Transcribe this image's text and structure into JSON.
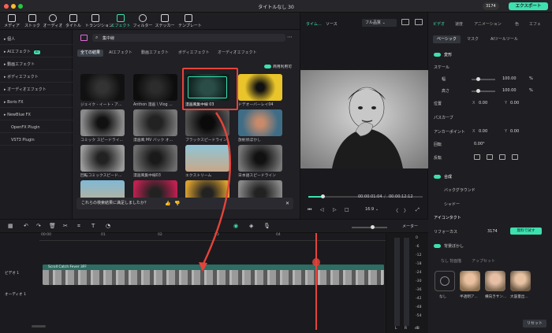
{
  "window": {
    "title": "タイトルなし 30",
    "credits": "3174",
    "export_label": "エクスポート"
  },
  "toolbar": {
    "items": [
      {
        "label": "メディア",
        "icon": "media-icon"
      },
      {
        "label": "ストック",
        "icon": "stock-icon"
      },
      {
        "label": "オーディオ",
        "icon": "music-icon"
      },
      {
        "label": "タイトル",
        "icon": "title-icon"
      },
      {
        "label": "トランジション",
        "icon": "transition-icon"
      },
      {
        "label": "エフェクト",
        "icon": "effects-icon"
      },
      {
        "label": "フィルター",
        "icon": "filter-icon"
      },
      {
        "label": "ステッカー",
        "icon": "sticker-icon"
      },
      {
        "label": "テンプレート",
        "icon": "template-icon"
      }
    ],
    "active": "エフェクト"
  },
  "sidebar": {
    "items": [
      {
        "label": "個人"
      },
      {
        "label": "AIエフェクト",
        "badge": "AI"
      },
      {
        "label": "動画エフェクト"
      },
      {
        "label": "ボディエフェクト"
      },
      {
        "label": "オーディオエフェクト"
      },
      {
        "label": "Boris FX"
      },
      {
        "label": "NewBlue FX"
      },
      {
        "label": "OpenFX Plugin"
      },
      {
        "label": "VST3 Plugin"
      }
    ]
  },
  "browser": {
    "search_value": "集中線",
    "category_tabs": [
      "全ての結果",
      "AIエフェクト",
      "動画エフェクト",
      "ボディエフェクト",
      "オーディオエフェクト"
    ],
    "commercial_toggle_label": "商用利用可",
    "feedback_text": "これらの検索結果に満足しましたか？",
    "tiles": [
      {
        "label": "ジェイク - イート・ア..."
      },
      {
        "label": "Anthon 漫画 \\ Vlog ..."
      },
      {
        "label": "漫画風集中線 03"
      },
      {
        "label": "ドデオーバーレイ04"
      },
      {
        "label": "コミック スピードライ..."
      },
      {
        "label": "漫画風 MV バック オ..."
      },
      {
        "label": "ブラックスピードライン"
      },
      {
        "label": "放射状ぼかし"
      },
      {
        "label": "回転コミックスピード..."
      },
      {
        "label": "漫画風集中線03"
      },
      {
        "label": "エクストリーム"
      },
      {
        "label": "日本語スピードライン"
      },
      {
        "label": ""
      },
      {
        "label": ""
      },
      {
        "label": ""
      },
      {
        "label": ""
      }
    ]
  },
  "player": {
    "tabs": [
      "タイム...",
      "ソース"
    ],
    "quality": "フル品質",
    "current_time": "00:00:01:04",
    "total_time": "00:00:12:12",
    "ratio": "16:9"
  },
  "props": {
    "tabs": [
      "ビデオ",
      "速度",
      "アニメーション",
      "色",
      "エフェ"
    ],
    "subtabs": [
      "ベーシック",
      "マスク",
      "AIツールツール"
    ],
    "transform_label": "変形",
    "scale_label": "スケール",
    "w_label": "幅",
    "h_label": "高さ",
    "scale_w": "100.00",
    "scale_h": "100.00",
    "pct": "%",
    "position_label": "位置",
    "pos_x": "0.00",
    "pos_y": "0.00",
    "path_label": "パスカーブ",
    "anchor_label": "アンカーポイント",
    "anchor_x": "0.00",
    "anchor_y": "0.00",
    "rotate_label": "回転",
    "rotate_value": "0.00°",
    "flip_label": "反転",
    "composite_label": "合成",
    "background_label": "バックグラウンド",
    "shadow_label": "シャドー",
    "ai_icon_label": "アイコンタクト",
    "refocus_label": "リフォーカス",
    "refocus_credits": "3174",
    "free_label": "無料で試す",
    "portrait_label": "背景ぼかし",
    "subtab2": [
      "なし",
      "背面描",
      "アップセット"
    ],
    "presets": [
      "なし",
      "半透明ア...",
      "横向きサン...",
      "大容量出..."
    ],
    "reset_label": "リセット"
  },
  "timeline": {
    "ticks": [
      "00:00",
      "01",
      "02",
      "03",
      "04"
    ],
    "clip_title": "Scroll Catch Fever 3FF",
    "video_track": "ビデオ 1",
    "audio_track": "オーディオ 1",
    "meter_label": "メーター",
    "meter_marks": [
      "0",
      "-6",
      "-12",
      "-18",
      "-24",
      "-30",
      "-36",
      "-42",
      "-48",
      "-54"
    ],
    "meter_lr": [
      "L",
      "R",
      "dB"
    ]
  },
  "colors": {
    "accent": "#3ee0b0",
    "highlight": "#e5433a",
    "clip": "#2d7b70"
  }
}
